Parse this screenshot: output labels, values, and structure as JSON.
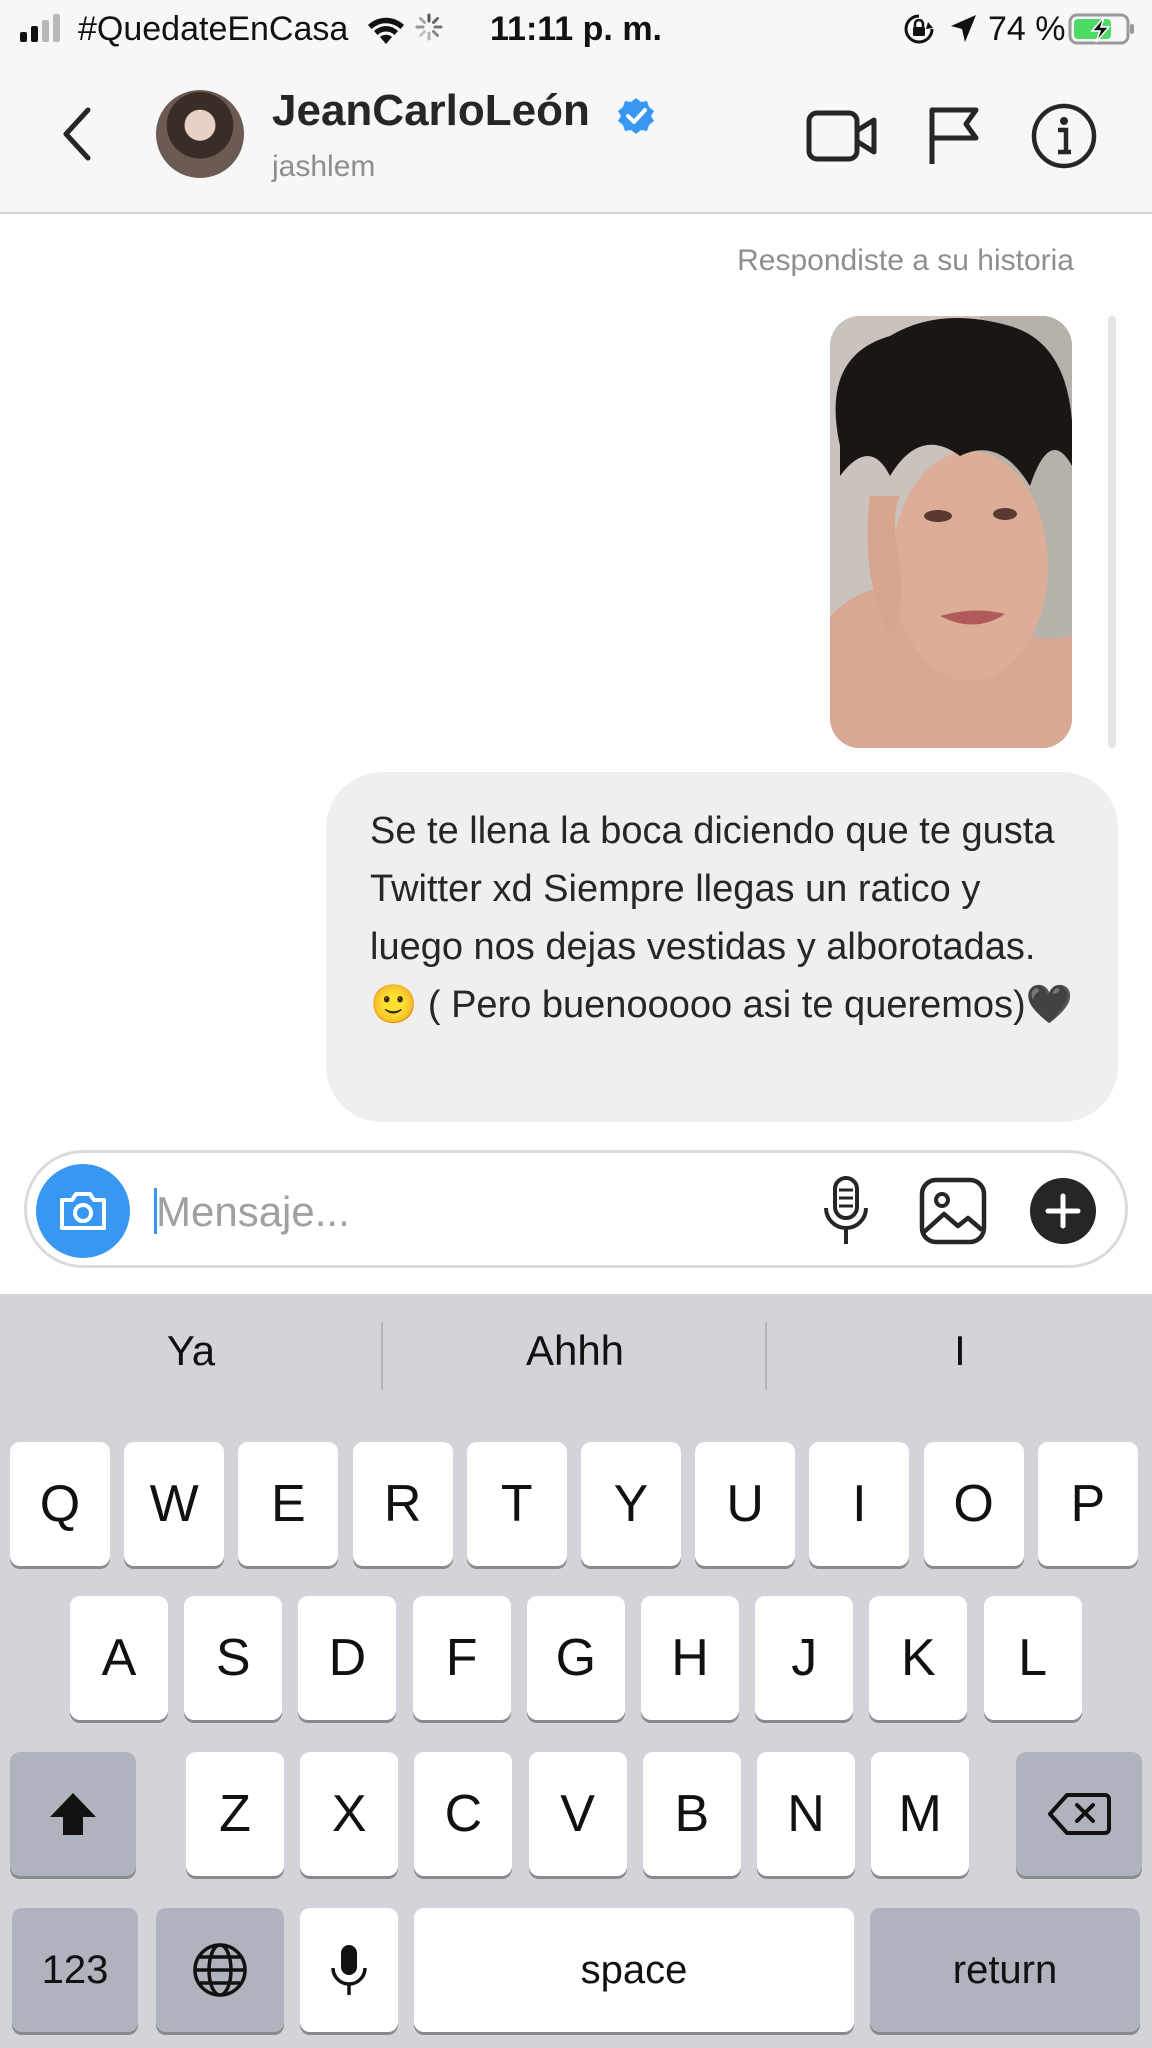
{
  "status_bar": {
    "carrier": "#QuedateEnCasa",
    "time": "11:11 p. m.",
    "battery": "74 %",
    "battery_level": 0.74
  },
  "header": {
    "name": "JeanCarloLeón",
    "username": "jashlem",
    "verified": true
  },
  "chat": {
    "story_reply_label": "Respondiste a su historia",
    "message": "Se te llena la boca diciendo que te gusta Twitter xd Siempre llegas un ratico y luego nos dejas vestidas y alborotadas.🙂 ( Pero buenooooo asi te queremos)🖤"
  },
  "composer": {
    "placeholder": "Mensaje...",
    "value": ""
  },
  "keyboard": {
    "suggestions": [
      "Ya",
      "Ahhh",
      "I"
    ],
    "row1": [
      "Q",
      "W",
      "E",
      "R",
      "T",
      "Y",
      "U",
      "I",
      "O",
      "P"
    ],
    "row2": [
      "A",
      "S",
      "D",
      "F",
      "G",
      "H",
      "J",
      "K",
      "L"
    ],
    "row3": [
      "Z",
      "X",
      "C",
      "V",
      "B",
      "N",
      "M"
    ],
    "numbers_label": "123",
    "space_label": "space",
    "return_label": "return"
  },
  "colors": {
    "accent": "#3897f0",
    "bubble": "#efefef",
    "keyboard_bg": "#d2d4da"
  },
  "icons": [
    "back-arrow-icon",
    "verified-badge-icon",
    "video-call-icon",
    "flag-icon",
    "info-icon",
    "camera-icon",
    "microphone-icon",
    "gallery-icon",
    "plus-icon",
    "shift-icon",
    "backspace-icon",
    "globe-icon",
    "dictation-mic-icon"
  ]
}
